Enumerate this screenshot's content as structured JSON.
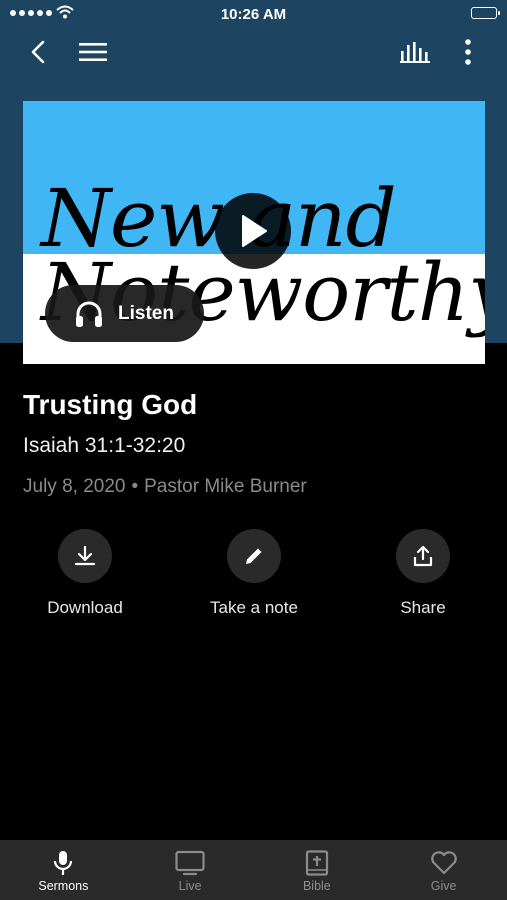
{
  "status_bar": {
    "time": "10:26 AM"
  },
  "nav": {
    "back_icon": "chevron-left-icon",
    "menu_icon": "hamburger-menu-icon",
    "audio_icon": "equalizer-icon",
    "more_icon": "more-vertical-icon"
  },
  "artwork": {
    "line1": "New and",
    "line2": "Noteworthy",
    "colors": {
      "top": "#40b6f4",
      "bottom": "#ffffff"
    }
  },
  "listen_button": {
    "label": "Listen",
    "icon": "headphones-icon"
  },
  "sermon": {
    "title": "Trusting God",
    "scripture": "Isaiah 31:1-32:20",
    "date": "July 8, 2020",
    "separator": "•",
    "speaker": "Pastor Mike Burner"
  },
  "actions": [
    {
      "label": "Download",
      "icon": "download-icon"
    },
    {
      "label": "Take a note",
      "icon": "pencil-icon"
    },
    {
      "label": "Share",
      "icon": "share-icon"
    }
  ],
  "tabs": [
    {
      "label": "Sermons",
      "icon": "microphone-icon",
      "active": true
    },
    {
      "label": "Live",
      "icon": "tv-icon",
      "active": false
    },
    {
      "label": "Bible",
      "icon": "bible-icon",
      "active": false
    },
    {
      "label": "Give",
      "icon": "heart-icon",
      "active": false
    }
  ],
  "colors": {
    "header_bg": "#1d4561",
    "body_bg": "#000000",
    "tabbar_bg": "#2a2a2a"
  }
}
